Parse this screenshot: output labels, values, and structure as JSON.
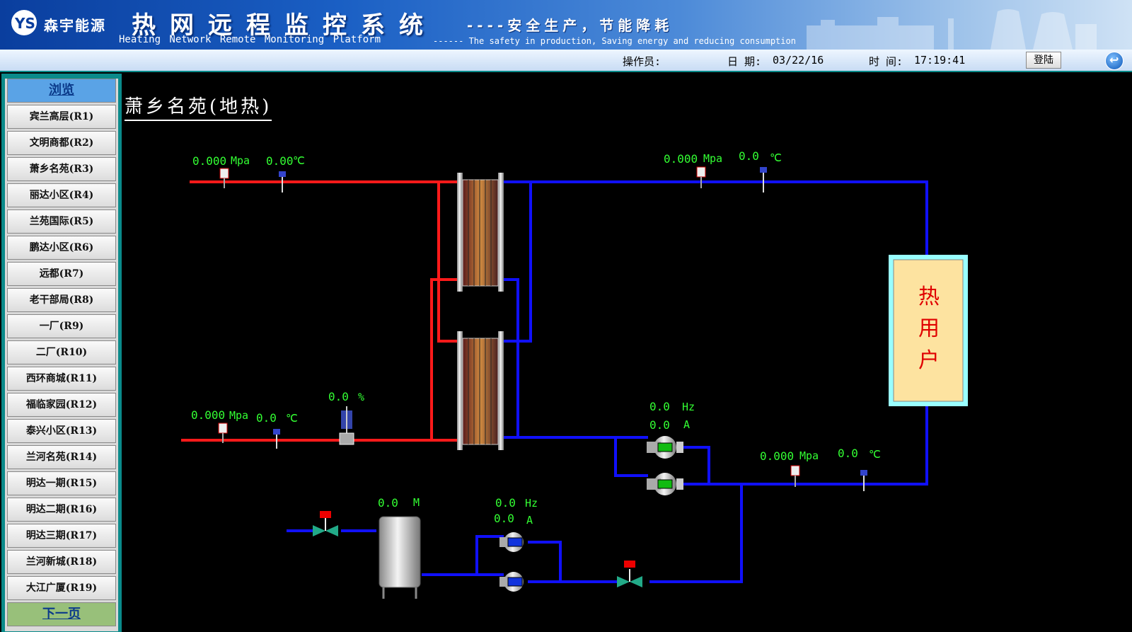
{
  "header": {
    "logo_text": "森宇能源",
    "title_cn": "热网远程监控系统",
    "slogan_cn": "----安全生产，节能降耗",
    "title_en": "Heating Network Remote Monitoring Platform",
    "slogan_en": "------ The safety in production, Saving energy and reducing consumption"
  },
  "infobar": {
    "operator_label": "操作员:",
    "date_label": "日  期:",
    "date_value": "03/22/16",
    "time_label": "时  间:",
    "time_value": "17:19:41",
    "login_label": "登陆"
  },
  "sidebar": {
    "header": "浏览",
    "items": [
      "宾兰高层(R1)",
      "文明商都(R2)",
      "萧乡名苑(R3)",
      "丽达小区(R4)",
      "兰苑国际(R5)",
      "鹏达小区(R6)",
      "远都(R7)",
      "老干部局(R8)",
      "一厂(R9)",
      "二厂(R10)",
      "西环商城(R11)",
      "福临家园(R12)",
      "泰兴小区(R13)",
      "兰河名苑(R14)",
      "明达一期(R15)",
      "明达二期(R16)",
      "明达三期(R17)",
      "兰河新城(R18)",
      "大江广厦(R19)"
    ],
    "next": "下一页"
  },
  "page_title": "萧乡名苑(地热)",
  "readings": {
    "supply_pressure": "0.000",
    "supply_pressure_unit": "Mpa",
    "supply_temp": "0.00",
    "supply_temp_unit": "℃",
    "sec_out_pressure": "0.000",
    "sec_out_pressure_unit": "Mpa",
    "sec_out_temp": "0.0",
    "sec_out_temp_unit": "℃",
    "return_pressure": "0.000",
    "return_pressure_unit": "Mpa",
    "return_temp": "0.0",
    "return_temp_unit": "℃",
    "valve_open": "0.0",
    "valve_open_unit": "%",
    "circ_pump_freq": "0.0",
    "circ_pump_freq_unit": "Hz",
    "circ_pump_current": "0.0",
    "circ_pump_current_unit": "A",
    "sec_ret_pressure": "0.000",
    "sec_ret_pressure_unit": "Mpa",
    "sec_ret_temp": "0.0",
    "sec_ret_temp_unit": "℃",
    "tank_level": "0.0",
    "tank_level_unit": "M",
    "makeup_pump_freq": "0.0",
    "makeup_pump_freq_unit": "Hz",
    "makeup_pump_current": "0.0",
    "makeup_pump_current_unit": "A"
  },
  "heat_user": {
    "c1": "热",
    "c2": "用",
    "c3": "户"
  },
  "colors": {
    "hot": "#ff1a1a",
    "cold": "#1010ff",
    "reading": "#33ff33"
  }
}
